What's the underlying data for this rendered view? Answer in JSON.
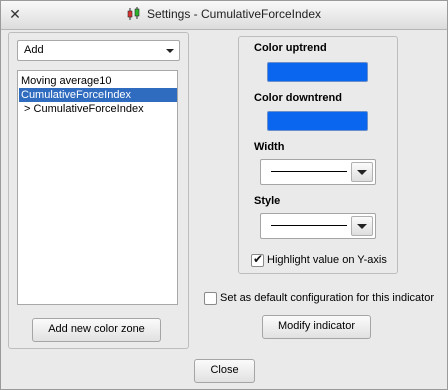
{
  "window": {
    "title": "Settings - CumulativeForceIndex",
    "close_glyph": "✕",
    "icon": "candlestick-chart-icon"
  },
  "left_panel": {
    "dropdown_value": "Add",
    "list_items": [
      "Moving average10",
      "CumulativeForceIndex",
      " > CumulativeForceIndex"
    ],
    "selected_index": 1,
    "add_zone_button": "Add new color zone"
  },
  "right_panel": {
    "color_uptrend_label": "Color uptrend",
    "color_uptrend": "#0a66ee",
    "color_downtrend_label": "Color downtrend",
    "color_downtrend": "#0a66ee",
    "width_label": "Width",
    "style_label": "Style",
    "highlight_label": "Highlight value on Y-axis",
    "highlight_checked": true
  },
  "footer": {
    "default_config_label": "Set as default configuration for this indicator",
    "default_config_checked": false,
    "modify_button": "Modify indicator",
    "close_button": "Close"
  }
}
